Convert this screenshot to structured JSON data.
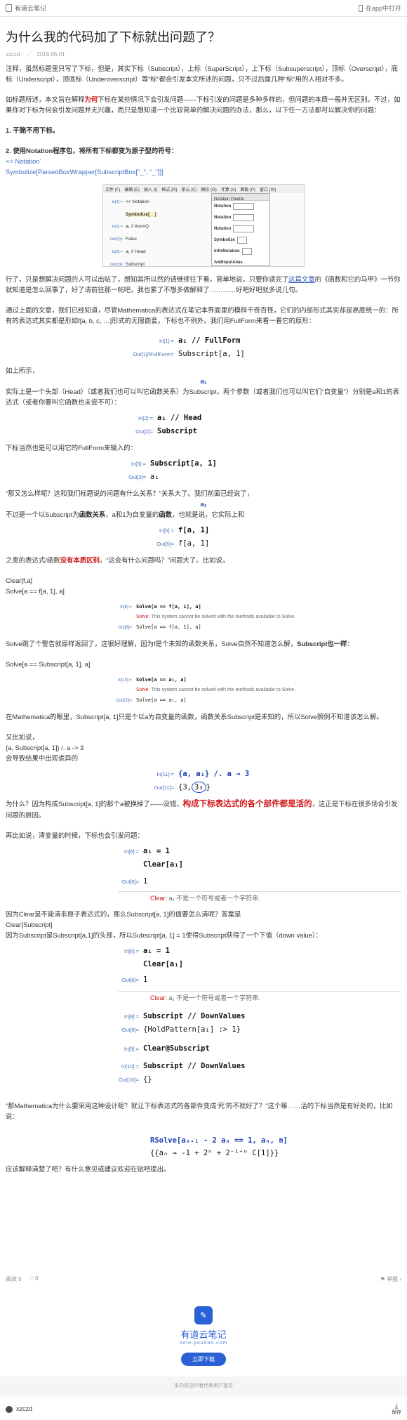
{
  "topbar": {
    "app_name": "有道云笔记",
    "open_in_app": "在app中打开"
  },
  "article": {
    "title": "为什么我的代码加了下标就出问题了？",
    "author": "xzczd",
    "date": "2019.06.01"
  },
  "p": {
    "intro": "注释，虽然标题里只写了下标，但是，其实下标（Subscript），上标（SuperScript），上下标（Subsuperscript），顶标（Overscript），底标（Underscript），顶底标（Underoverscript）等“标”都会引发本文所述的问题，只不过后面几种“标”用的人相对不多。",
    "para2_a": "如标题所述，本文旨在解释",
    "para2_red": "为何",
    "para2_b": "下标在某些情况下会引发问题——下标引发的问题是多种多样的，但问题的本质一般并无区别。不过，如果你对下标为何会引发问题并无兴趣，而只是想知道一个比较简单的解决问题的办法，那么，以下任一方法都可以解决你的问题：",
    "m1": "1. 干脆不用下标。",
    "m2": "2. 使用Notation程序包，将所有下标都变为原子型的符号：",
    "code1": "<< Notation`",
    "code2": "Symbolize[ParsedBoxWrapper[SubscriptBox[\"_\", \"_\"]]]",
    "after_shot_a": "行了，只是想解决问题的人可以出帖了，想知其所以然的请继续往下看。简单地说，只要你读完了",
    "after_shot_link": "这篇文章",
    "after_shot_b": "的《函数和它的马甲》一节你就知道是怎么回事了，好了请前往那一帖吧，我也累了不想多做解释了…………好吧好吧就多说几句。",
    "p3": "通过上面的文章，我们已经知道，尽管Mathematica的表达式在笔记本界面里的模样千奇百怪，它们的内部形式其实却是高度统一的：所有的表达式其实都是形如f[a, b, c, …]形式的无限嵌套，下标也不例外。我们用FullForm来看一看它的原形：",
    "p4": "如上所示，",
    "p5": "实际上是一个头部（Head）（或者我们也可以叫它函数关系）为Subscript，两个参数（或者我们也可以叫它们“自变量”）分别是a和1的表达式（或者你要叫它函数也未尝不可）：",
    "p6": "下标当然也是可以用它的FullForm来输入的：",
    "p7": "“那又怎么样呢？这和我们标题说的问题有什么关系？”关系大了。我们前面已经说了，",
    "p8_a": "不过是一个以Subscript为",
    "p8_b": "函数关系",
    "p8_c": "，a和1为自变量的",
    "p8_d": "函数",
    "p8_e": "，也就是说，它实际上和",
    "p9_a": "之类的表达式/函数",
    "p9_red": "没有本质区别",
    "p9_b": "。“这会有什么问题吗？”问题大了。比如说，",
    "c1": "Clear[f,a]",
    "c2": "Solve[a == f[a, 1], a]",
    "p10_a": "Solve跳了个警告就原样返回了，这很好理解，因为f是个未知的函数关系，Solve自然不知道怎么解，",
    "p10_b": "Subscript也一样",
    "p10_c": "：",
    "c3": "Solve[a == Subscript[a, 1], a]",
    "p11": "在Mathematica的眼里，Subscript[a, 1]只是个以a为自变量的函数，函数关系Subscript是未知的，所以Solve照例不知道该怎么解。",
    "p12": "又比如说，",
    "c4": "{a, Subscript[a, 1]} /. a -> 3",
    "p13": "会导致结果中出现诡异的",
    "p14_a": "为什么？因为构成Subscript[a, 1]的那个a被换掉了——没错，",
    "p14_red": "构成下标表达式的各个部件都是活的",
    "p14_b": "，这正是下标在很多场合引发问题的原因。",
    "p15": "再比如说，清变量的时候，下标也会引发问题：",
    "p16_a": "因为Clear是不能清非原子表达式的，那么Subscript[a, 1]的值要怎么清呢？答案是",
    "p16_b": "Clear[Subscript]",
    "p16_c": "因为Subscript是Subscript[a,1]的头部，所以Subscript[a, 1] = 1使得Subscript获得了一个下值（down value）：",
    "p17": "“那Mathematica为什么要采用这种设计呢？就让下标表达式的各部件变成‘死’的不就好了？”这个嘛……活的下标当然是有好处的，比如说：",
    "p18": "应该解释清楚了吧？有什么意见或建议欢迎在贴吧提出。"
  },
  "mma": {
    "in1": "In[1]:=",
    "in1_code": "a₁ // FullForm",
    "out1": "Out[1]//FullForm=",
    "out1_val": "Subscript[a, 1]",
    "a1": "a₁",
    "in2": "In[2]:=",
    "in2_code": "a₁ // Head",
    "out2": "Out[2]=",
    "out2_val": "Subscript",
    "in3": "In[3]:=",
    "in3_code": "Subscript[a, 1]",
    "out3": "Out[3]=",
    "out3_val": "a₁",
    "in5": "In[5]:=",
    "in5_code": "f[a, 1]",
    "out5": "Out[5]=",
    "out5_val": "f[a, 1]",
    "in8": "In[8]:=",
    "in8_code": "Solve[a == f[a, 1], a]",
    "msg_solve_head": "Solve:",
    "msg_solve": "This system cannot be solved with the methods available to Solve.",
    "out8": "Out[8]=",
    "out8_val": "Solve[a == f[a, 1], a]",
    "in10": "In[10]:=",
    "in10_code": "Solve[a == a₁, a]",
    "out10": "Out[10]=",
    "out10_val": "Solve[a == a₁, a]",
    "in11": "In[11]:=",
    "in11_code": "{a, a₁} /. a → 3",
    "out11": "Out[11]=",
    "out11_first": "{3,",
    "out11_circle": "3₃",
    "out11_last": "}",
    "in6": "In[6]:=",
    "in6_code1": "a₁ = 1",
    "in6_code2": "Clear[a₁]",
    "out6": "Out[6]=",
    "out6_val": "1",
    "msg_clear_head": "Clear:",
    "msg_clear": "a₁ 不是一个符号或者一个字符串.",
    "in8b": "In[8]:=",
    "in8b_code": "Subscript // DownValues",
    "out8b": "Out[8]=",
    "out8b_val": "{HoldPattern[a₁] :> 1}",
    "in9": "In[9]:=",
    "in9_code": "Clear@Subscript",
    "in10b": "In[10]:=",
    "in10b_code": "Subscript // DownValues",
    "out10b": "Out[10]=",
    "out10b_val": "{}",
    "rsolve_code": "RSolve[aₙ₊₁ - 2 aₙ == 1, aₙ, n]",
    "rsolve_out": "{{aₙ → -1 + 2ⁿ + 2⁻¹⁺ⁿ C[1]}}"
  },
  "shot": {
    "menus": [
      "文件 (F)",
      "编辑 (E)",
      "插入 (I)",
      "格式 (R)",
      "单元 (C)",
      "图形 (G)",
      "计算 (V)",
      "面板 (P)",
      "窗口 (W)"
    ],
    "l1": "In[1]:=",
    "t1": "<< Notation`",
    "t2": "Symbolize[ _ ]",
    "l3": "In[2]:=",
    "t3": "a₁ // AtomQ",
    "l4": "Out[2]=",
    "t4": "False",
    "l5": "In[3]:=",
    "t5": "a₁ // Head",
    "l6": "Out[3]=",
    "t6": "Subscript",
    "pal_title": "Notation Palette",
    "pal_rows": [
      "Notation",
      "Notation",
      "Notation",
      "Symbolize",
      "InfixNotation",
      "AddInputAlias"
    ]
  },
  "footer": {
    "reads": "阅读 5",
    "likes": "0",
    "report": "举报",
    "brand": "有道云笔记",
    "brand_url": "note.youdao.com",
    "download": "立即下载",
    "notice": "本内容由作者代表用户提交",
    "user": "xzczd",
    "save": "保存"
  }
}
